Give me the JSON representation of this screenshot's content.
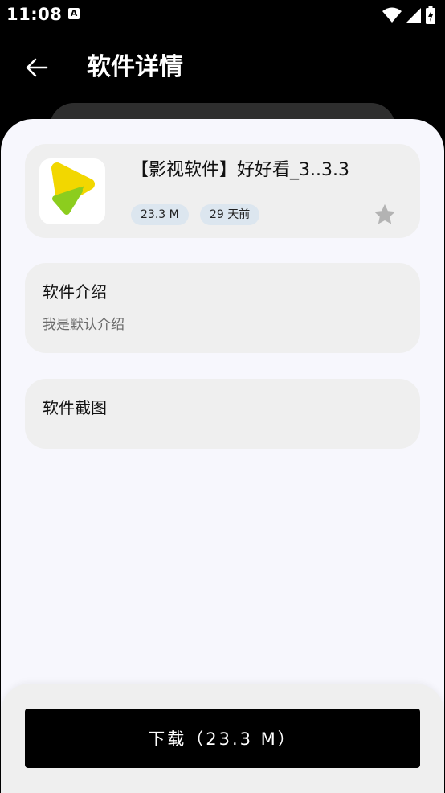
{
  "status_bar": {
    "time": "11:08",
    "notification_icon": "a-icon",
    "icons": [
      "wifi-icon",
      "signal-icon",
      "battery-charging-icon"
    ]
  },
  "header": {
    "title": "软件详情",
    "back_icon": "arrow-left-icon"
  },
  "app": {
    "name": "【影视软件】好好看_3..3.3",
    "size": "23.3 M",
    "age": "29 天前",
    "icon": "play-logo-icon",
    "favorite_icon": "star-icon",
    "colors": {
      "logo_yellow": "#f2d700",
      "logo_green": "#8ccd1e"
    }
  },
  "intro": {
    "title": "软件介绍",
    "text": "我是默认介绍"
  },
  "screenshots": {
    "title": "软件截图"
  },
  "download": {
    "label": "下载（23.3 M）"
  },
  "colors": {
    "sheet_background": "#f7f7fd",
    "card_background": "#efefef",
    "badge_background": "#dce6ef",
    "button_background": "#000000",
    "star_color": "#b3b3b3"
  }
}
